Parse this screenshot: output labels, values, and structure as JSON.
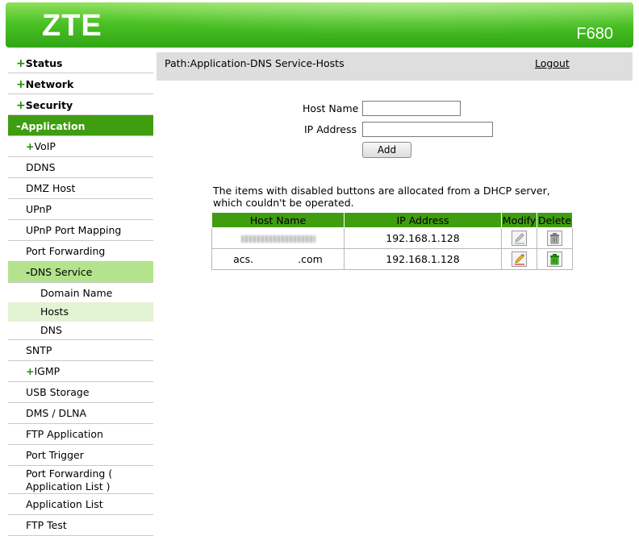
{
  "header": {
    "brand": "ZTE",
    "model": "F680"
  },
  "sidebar": {
    "top": [
      {
        "pm": "+",
        "label": "Status"
      },
      {
        "pm": "+",
        "label": "Network"
      },
      {
        "pm": "+",
        "label": "Security"
      },
      {
        "pm": "-",
        "label": "Application"
      }
    ],
    "items": [
      {
        "pm": "+",
        "label": "VoIP"
      },
      {
        "label": "DDNS"
      },
      {
        "label": "DMZ Host"
      },
      {
        "label": "UPnP"
      },
      {
        "label": "UPnP Port Mapping"
      },
      {
        "label": "Port Forwarding"
      },
      {
        "pm": "-",
        "label": "DNS Service"
      },
      {
        "label": "Domain Name"
      },
      {
        "label": "Hosts"
      },
      {
        "label": "DNS"
      },
      {
        "label": "SNTP"
      },
      {
        "pm": "+",
        "label": "IGMP"
      },
      {
        "label": "USB Storage"
      },
      {
        "label": "DMS / DLNA"
      },
      {
        "label": "FTP Application"
      },
      {
        "label": "Port Trigger"
      },
      {
        "label": "Port Forwarding ( Application List )"
      },
      {
        "label": "Application List"
      },
      {
        "label": "FTP Test"
      }
    ]
  },
  "path": {
    "text": "Path:Application-DNS Service-Hosts",
    "logout": "Logout"
  },
  "form": {
    "host_label": "Host Name",
    "host_value": "",
    "ip_label": "IP Address",
    "ip_value": "",
    "add_label": "Add"
  },
  "note": "The items with disabled buttons are allocated from a DHCP server, which couldn't be operated.",
  "table": {
    "headers": [
      "Host Name",
      "IP Address",
      "Modify",
      "Delete"
    ],
    "rows": [
      {
        "host_prefix": "",
        "host_suffix": "",
        "ip": "192.168.1.128",
        "enabled": false
      },
      {
        "host_prefix": "acs.",
        "host_suffix": ".com",
        "ip": "192.168.1.128",
        "enabled": true
      }
    ]
  },
  "colors": {
    "brand_green": "#3f9d10",
    "sub_active": "#b4e38e",
    "third_active": "#e2f3d3"
  }
}
